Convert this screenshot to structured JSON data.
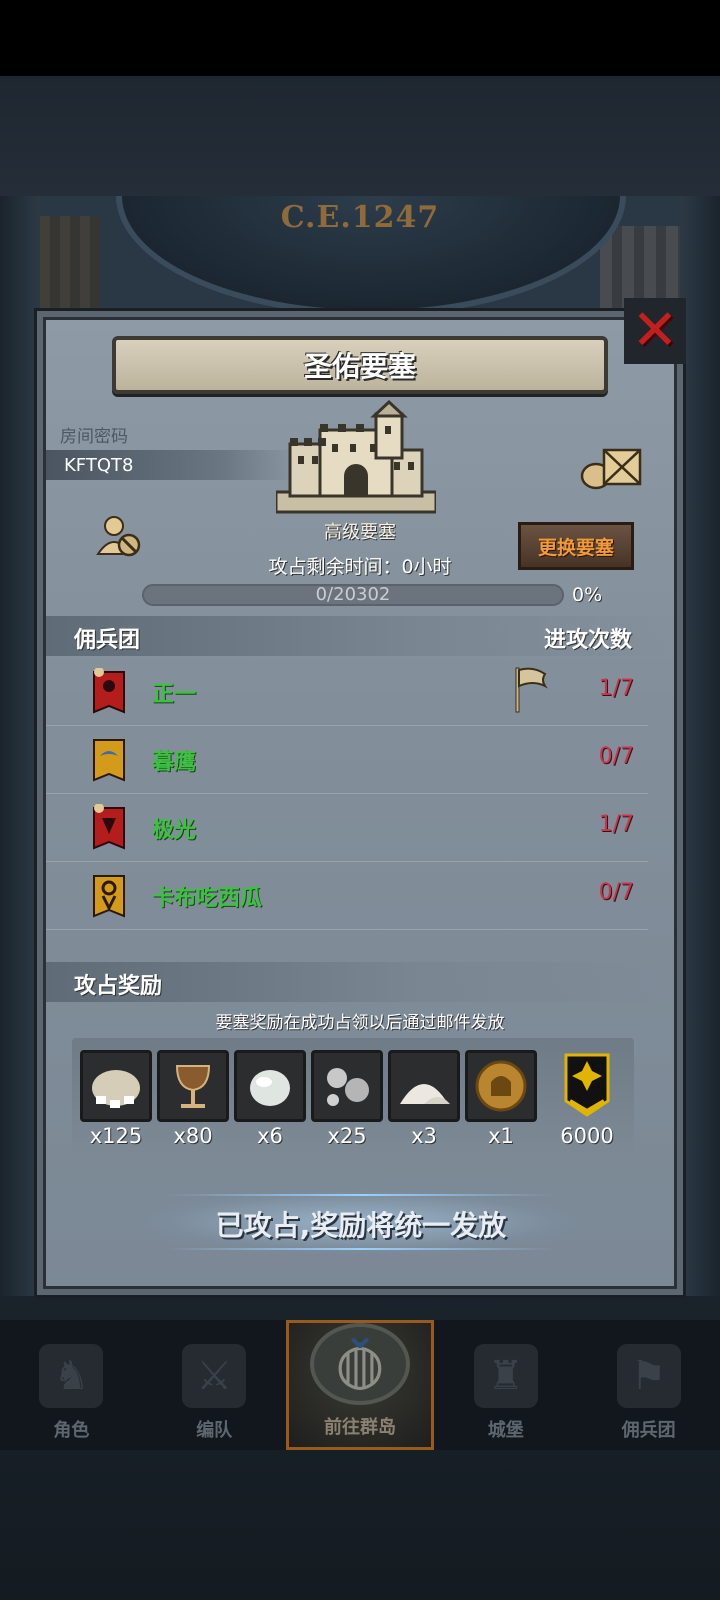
{
  "background": {
    "era_label": "C.E.1247"
  },
  "dialog": {
    "title": "圣佑要塞",
    "room_password_label": "房间密码",
    "room_password": "KFTQT8",
    "fortress_grade": "高级要塞",
    "change_button": "更换要塞",
    "time_left": "攻占剩余时间：0小时",
    "progress": {
      "text": "0/20302",
      "percent_text": "0%",
      "value": 0,
      "max": 20302
    }
  },
  "mercenary_section": {
    "title": "佣兵团",
    "attacks_header": "进攻次数",
    "rows": [
      {
        "name": "正一",
        "attacks": "1/7",
        "banner_color": "#b51d1d",
        "flag": true
      },
      {
        "name": "暮鹰",
        "attacks": "0/7",
        "banner_color": "#d49a1a",
        "flag": false
      },
      {
        "name": "极光",
        "attacks": "1/7",
        "banner_color": "#b51d1d",
        "flag": false
      },
      {
        "name": "卡布吃西瓜",
        "attacks": "0/7",
        "banner_color": "#d49a1a",
        "flag": false
      }
    ]
  },
  "reward_section": {
    "title": "攻占奖励",
    "note": "要塞奖励在成功占领以后通过邮件发放",
    "items": [
      {
        "icon": "silver-sack-icon",
        "qty": "x125"
      },
      {
        "icon": "goblet-icon",
        "qty": "x80"
      },
      {
        "icon": "white-stone-icon",
        "qty": "x6"
      },
      {
        "icon": "mercury-drops-icon",
        "qty": "x25"
      },
      {
        "icon": "salt-pile-icon",
        "qty": "x3"
      },
      {
        "icon": "knight-medal-icon",
        "qty": "x1"
      },
      {
        "icon": "rank-badge-icon",
        "qty": "6000"
      }
    ]
  },
  "status_text": "已攻占,奖励将统一发放",
  "nav": [
    {
      "label": "角色",
      "active": false
    },
    {
      "label": "编队",
      "active": false
    },
    {
      "label": "前往群岛",
      "active": true
    },
    {
      "label": "城堡",
      "active": false
    },
    {
      "label": "佣兵团",
      "active": false
    }
  ]
}
